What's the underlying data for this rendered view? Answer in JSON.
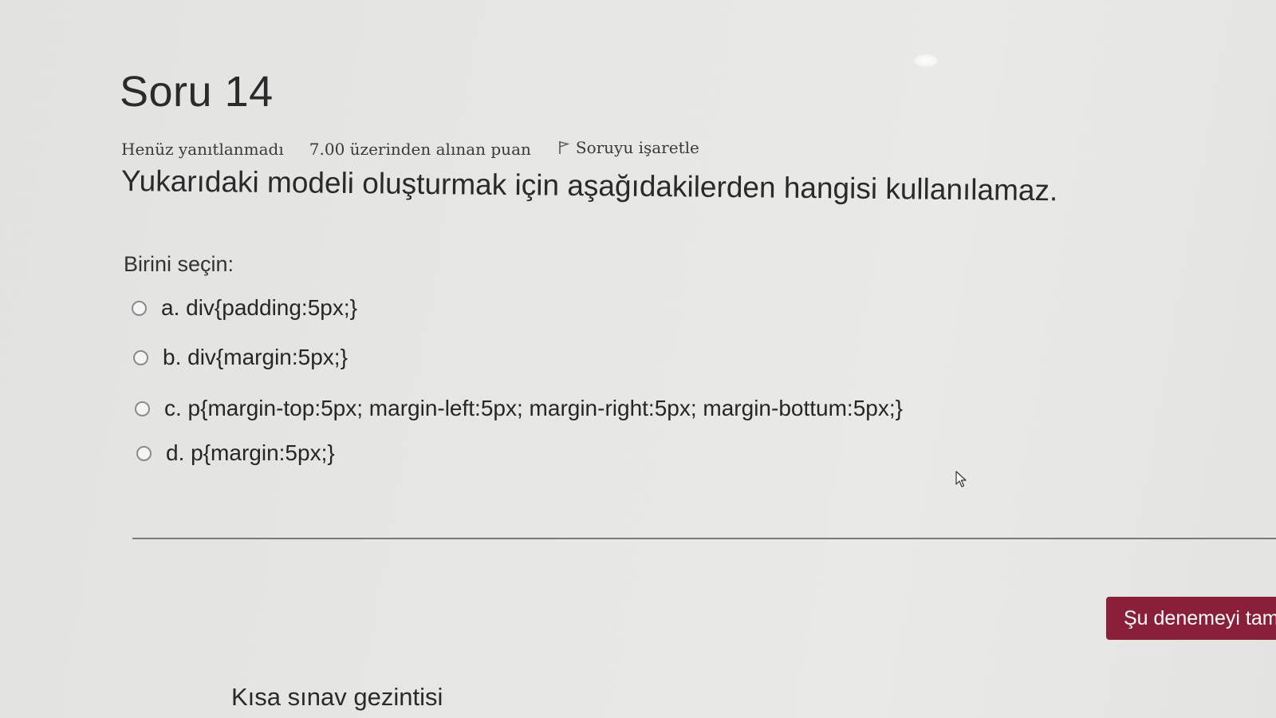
{
  "question": {
    "title": "Soru 14",
    "status": "Henüz yanıtlanmadı",
    "grade": "7.00 üzerinden alınan puan",
    "flag_label": "Soruyu işaretle",
    "text": "Yukarıdaki modeli oluşturmak için aşağıdakilerden hangisi kullanılamaz.",
    "prompt": "Birini seçin:",
    "answers": [
      {
        "label": "a. div{padding:5px;}"
      },
      {
        "label": "b. div{margin:5px;}"
      },
      {
        "label": "c. p{margin-top:5px; margin-left:5px; margin-right:5px; margin-bottum:5px;}"
      },
      {
        "label": "d. p{margin:5px;}"
      }
    ]
  },
  "footer": {
    "finish_button": "Şu denemeyi tamamla ...",
    "quiz_navigation": "Kısa sınav gezintisi"
  },
  "icons": {
    "flag": "flag-icon",
    "radio": "radio-icon",
    "cursor": "cursor-icon"
  },
  "colors": {
    "finish_button_bg": "#8a1f3a",
    "background": "#e6e6e4"
  }
}
